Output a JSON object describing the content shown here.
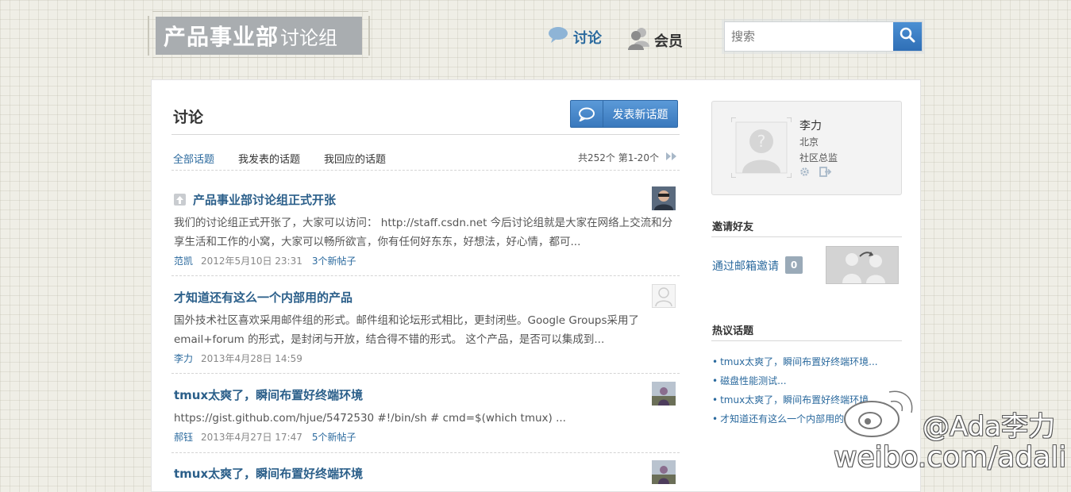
{
  "logo": {
    "main": "产品事业部",
    "sub": "讨论组"
  },
  "topnav": {
    "discuss": "讨论",
    "members": "会员"
  },
  "search": {
    "placeholder": "搜索"
  },
  "main": {
    "title": "讨论",
    "new_topic_label": "发表新话题",
    "tabs": [
      "全部话题",
      "我发表的话题",
      "我回应的话题"
    ],
    "pager": "共252个 第1-20个",
    "topics": [
      {
        "title": "产品事业部讨论组正式开张",
        "excerpt": "我们的讨论组正式开张了，大家可以访问： http://staff.csdn.net 今后讨论组就是大家在网络上交流和分享生活和工作的小窝，大家可以畅所欲言，你有任何好东东，好想法，好心情，都可...",
        "author": "范凯",
        "date": "2012年5月10日 23:31",
        "count": "3个新帖子",
        "pinned": true
      },
      {
        "title": "才知道还有这么一个内部用的产品",
        "excerpt": "国外技术社区喜欢采用邮件组的形式。邮件组和论坛形式相比，更封闭些。Google Groups采用了email+forum 的形式，是封闭与开放，结合得不错的形式。 这个产品，是否可以集成到...",
        "author": "李力",
        "date": "2013年4月28日 14:59",
        "count": ""
      },
      {
        "title": "tmux太爽了，瞬间布置好终端环境",
        "excerpt": "https://gist.github.com/hjue/5472530 #!/bin/sh # cmd=$(which tmux) ...",
        "author": "郝钰",
        "date": "2013年4月27日 17:47",
        "count": "5个新帖子"
      },
      {
        "title": "tmux太爽了，瞬间布置好终端环境",
        "excerpt": "",
        "author": "",
        "date": "",
        "count": ""
      }
    ]
  },
  "profile": {
    "name": "李力",
    "city": "北京",
    "role": "社区总监"
  },
  "invite": {
    "heading": "邀请好友",
    "link": "通过邮箱邀请",
    "count": "0"
  },
  "hot": {
    "heading": "热议话题",
    "items": [
      "tmux太爽了，瞬间布置好终端环境...",
      "磁盘性能测试...",
      "tmux太爽了，瞬间布置好终端环境...",
      "才知道还有这么一个内部用的产品..."
    ]
  },
  "watermark": {
    "handle": "@Ada李力",
    "site": "weibo.com/adali"
  },
  "colors": {
    "link": "#2b6a9e",
    "button": "#3a79bd",
    "background": "#efeee6"
  }
}
